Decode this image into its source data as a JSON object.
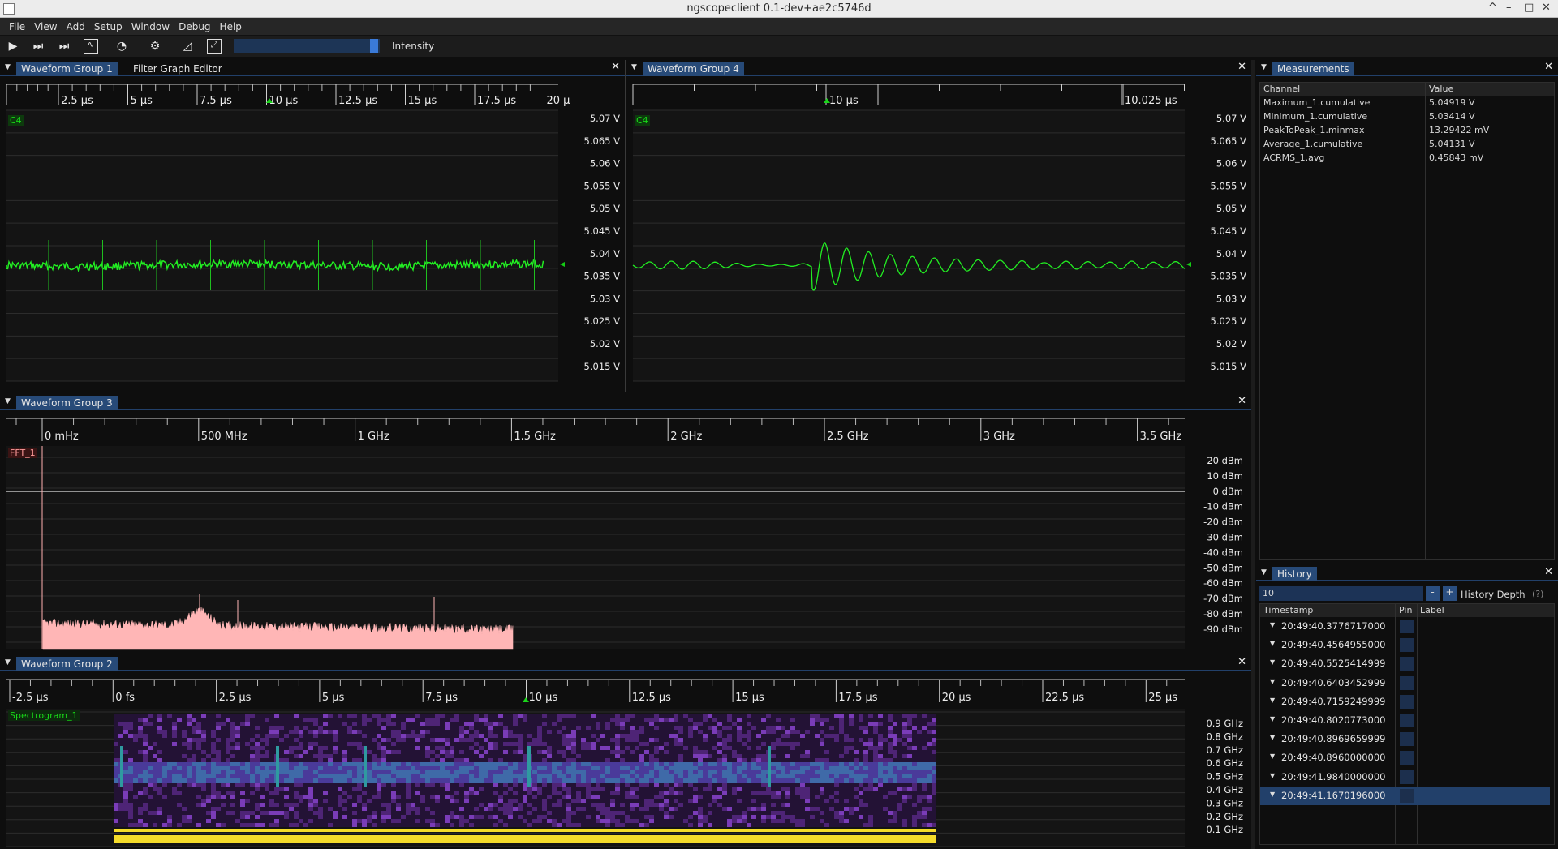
{
  "window": {
    "title": "ngscopeclient 0.1-dev+ae2c5746d",
    "controls": [
      "^",
      "–",
      "□",
      "✕"
    ]
  },
  "menu": [
    "File",
    "View",
    "Add",
    "Setup",
    "Window",
    "Debug",
    "Help"
  ],
  "toolbar": {
    "intensity_label": "Intensity",
    "intensity_level": 0.99
  },
  "wg1": {
    "tabs": [
      "Waveform Group 1",
      "Filter Graph Editor"
    ],
    "channel": "C4",
    "time_ticks": [
      "2.5 µs",
      "5 µs",
      "7.5 µs",
      "10 µs",
      "12.5 µs",
      "15 µs",
      "17.5 µs",
      "20 µ"
    ]
  },
  "wg4": {
    "tabs": [
      "Waveform Group 4"
    ],
    "channel": "C4",
    "time_ticks": [
      "10 µs",
      "10.025 µs"
    ]
  },
  "volt_ticks": [
    "5.07 V",
    "5.065 V",
    "5.06 V",
    "5.055 V",
    "5.05 V",
    "5.045 V",
    "5.04 V",
    "5.035 V",
    "5.03 V",
    "5.025 V",
    "5.02 V",
    "5.015 V"
  ],
  "wg3": {
    "tabs": [
      "Waveform Group 3"
    ],
    "channel": "FFT_1",
    "freq_ticks": [
      "0 mHz",
      "500 MHz",
      "1 GHz",
      "1.5 GHz",
      "2 GHz",
      "2.5 GHz",
      "3 GHz",
      "3.5 GHz"
    ],
    "dbm_ticks": [
      "20 dBm",
      "10 dBm",
      "0 dBm",
      "-10 dBm",
      "-20 dBm",
      "-30 dBm",
      "-40 dBm",
      "-50 dBm",
      "-60 dBm",
      "-70 dBm",
      "-80 dBm",
      "-90 dBm"
    ]
  },
  "wg2": {
    "tabs": [
      "Waveform Group 2"
    ],
    "channel": "Spectrogram_1",
    "time_ticks": [
      "-2.5 µs",
      "0 fs",
      "2.5 µs",
      "5 µs",
      "7.5 µs",
      "10 µs",
      "12.5 µs",
      "15 µs",
      "17.5 µs",
      "20 µs",
      "22.5 µs",
      "25 µs"
    ],
    "ghz_ticks": [
      "0.9 GHz",
      "0.8 GHz",
      "0.7 GHz",
      "0.6 GHz",
      "0.5 GHz",
      "0.4 GHz",
      "0.3 GHz",
      "0.2 GHz",
      "0.1 GHz"
    ]
  },
  "measurements": {
    "tab": "Measurements",
    "headers": [
      "Channel",
      "Value"
    ],
    "rows": [
      [
        "Maximum_1.cumulative",
        "5.04919 V"
      ],
      [
        "Minimum_1.cumulative",
        "5.03414 V"
      ],
      [
        "PeakToPeak_1.minmax",
        "13.29422 mV"
      ],
      [
        "Average_1.cumulative",
        "5.04131 V"
      ],
      [
        "ACRMS_1.avg",
        "0.45843 mV"
      ]
    ]
  },
  "history": {
    "tab": "History",
    "depth_value": "10",
    "minus": "-",
    "plus": "+",
    "depth_label": "History Depth",
    "help": "(?)",
    "headers": [
      "Timestamp",
      "Pin",
      "Label"
    ],
    "rows": [
      "20:49:40.3776717000",
      "20:49:40.4564955000",
      "20:49:40.5525414999",
      "20:49:40.6403452999",
      "20:49:40.7159249999",
      "20:49:40.8020773000",
      "20:49:40.8969659999",
      "20:49:40.8960000000",
      "20:49:41.9840000000",
      "20:49:41.1670196000"
    ],
    "selected_index": 9
  }
}
